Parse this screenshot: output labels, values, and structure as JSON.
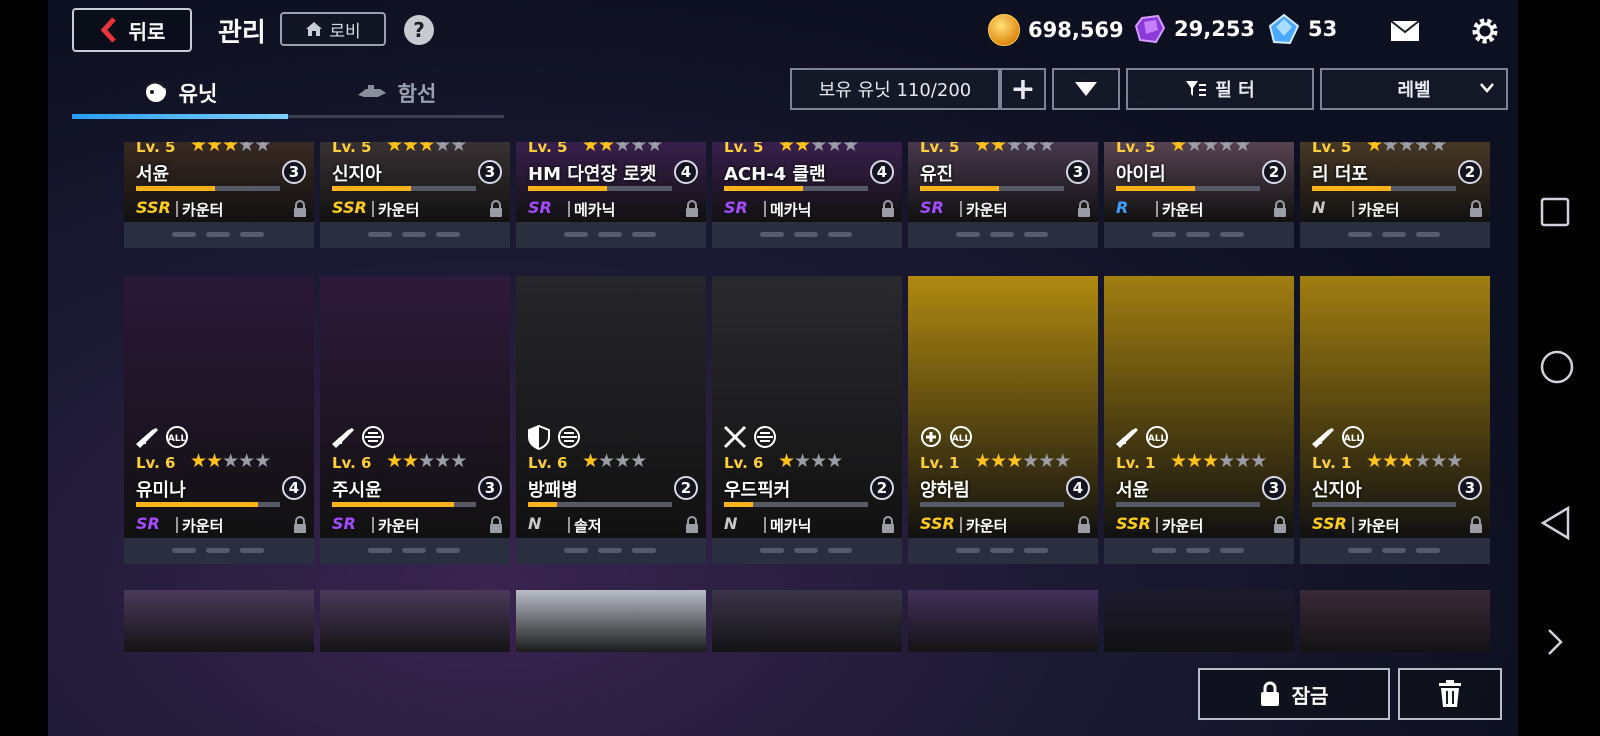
{
  "header": {
    "back_label": "뒤로",
    "title": "관리",
    "lobby_label": "로비",
    "help_label": "?",
    "currencies": [
      {
        "icon": "gold-coin-icon",
        "value": "698,569"
      },
      {
        "icon": "purple-gem-icon",
        "value": "29,253"
      },
      {
        "icon": "blue-crystal-icon",
        "value": "53"
      }
    ]
  },
  "tabs": [
    {
      "label": "유닛",
      "icon": "unit-head-icon",
      "active": true
    },
    {
      "label": "함선",
      "icon": "ship-icon",
      "active": false
    }
  ],
  "controls": {
    "owned_units": "보유 유닛 110/200",
    "add_label": "+",
    "filter_label": "필 터",
    "sort_label": "레벨"
  },
  "rows": [
    [
      {
        "level": "Lv. 5",
        "stars": 3,
        "max_stars": 5,
        "name": "서윤",
        "exp": 0.55,
        "badge": "3",
        "rarity": "SSR",
        "class": "카운터",
        "bg": "#3a2a24"
      },
      {
        "level": "Lv. 5",
        "stars": 3,
        "max_stars": 5,
        "name": "신지아",
        "exp": 0.55,
        "badge": "3",
        "rarity": "SSR",
        "class": "카운터",
        "bg": "#3a3336"
      },
      {
        "level": "Lv. 5",
        "stars": 2,
        "max_stars": 5,
        "name": "HM 다연장 로켓",
        "exp": 0.55,
        "badge": "4",
        "rarity": "SR",
        "class": "메카닉",
        "bg": "#3a2050"
      },
      {
        "level": "Lv. 5",
        "stars": 2,
        "max_stars": 5,
        "name": "ACH-4 클랜",
        "exp": 0.55,
        "badge": "4",
        "rarity": "SR",
        "class": "메카닉",
        "bg": "#3a2050"
      },
      {
        "level": "Lv. 5",
        "stars": 2,
        "max_stars": 5,
        "name": "유진",
        "exp": 0.55,
        "badge": "3",
        "rarity": "SR",
        "class": "카운터",
        "bg": "#4a3a50"
      },
      {
        "level": "Lv. 5",
        "stars": 1,
        "max_stars": 5,
        "name": "아이리",
        "exp": 0.55,
        "badge": "2",
        "rarity": "R",
        "class": "카운터",
        "bg": "#5a4654"
      },
      {
        "level": "Lv. 5",
        "stars": 1,
        "max_stars": 5,
        "name": "리 더포",
        "exp": 0.55,
        "badge": "2",
        "rarity": "N",
        "class": "카운터",
        "bg": "#4a3a26"
      }
    ],
    [
      {
        "level": "Lv. 6",
        "stars": 2,
        "max_stars": 5,
        "name": "유미나",
        "exp": 0.85,
        "badge": "4",
        "rarity": "SR",
        "class": "카운터",
        "bg": "#2a1838",
        "icons": [
          "rifle-icon",
          "all-target-icon"
        ]
      },
      {
        "level": "Lv. 6",
        "stars": 2,
        "max_stars": 5,
        "name": "주시윤",
        "exp": 0.85,
        "badge": "3",
        "rarity": "SR",
        "class": "카운터",
        "bg": "#2e1a3a",
        "icons": [
          "rifle-icon",
          "ground-target-icon"
        ]
      },
      {
        "level": "Lv. 6",
        "stars": 1,
        "max_stars": 4,
        "name": "방패병",
        "exp": 0.2,
        "badge": "2",
        "rarity": "N",
        "class": "솔저",
        "bg": "#26262a",
        "icons": [
          "shield-icon",
          "ground-target-icon"
        ]
      },
      {
        "level": "Lv. 6",
        "stars": 1,
        "max_stars": 4,
        "name": "우드픽커",
        "exp": 0.2,
        "badge": "2",
        "rarity": "N",
        "class": "메카닉",
        "bg": "#2a2a2e",
        "icons": [
          "crossed-swords-icon",
          "ground-target-icon"
        ]
      },
      {
        "level": "Lv. 1",
        "stars": 3,
        "max_stars": 6,
        "name": "양하림",
        "exp": 0.0,
        "badge": "4",
        "rarity": "SSR",
        "class": "카운터",
        "bg": "#b08a10",
        "icons": [
          "support-icon",
          "all-target-icon"
        ]
      },
      {
        "level": "Lv. 1",
        "stars": 3,
        "max_stars": 6,
        "name": "서윤",
        "exp": 0.0,
        "badge": "3",
        "rarity": "SSR",
        "class": "카운터",
        "bg": "#a07e10",
        "icons": [
          "rifle-icon",
          "all-target-icon"
        ]
      },
      {
        "level": "Lv. 1",
        "stars": 3,
        "max_stars": 6,
        "name": "신지아",
        "exp": 0.0,
        "badge": "3",
        "rarity": "SSR",
        "class": "카운터",
        "bg": "#a07e10",
        "icons": [
          "rifle-icon",
          "all-target-icon"
        ]
      }
    ],
    [
      {
        "bg": "#4a3a5a"
      },
      {
        "bg": "#4a3a5a"
      },
      {
        "bg": "#b8bcc6"
      },
      {
        "bg": "#3a3448"
      },
      {
        "bg": "#42305a"
      },
      {
        "bg": "#1e1a2e"
      },
      {
        "bg": "#3a2a36"
      }
    ]
  ],
  "bottom": {
    "lock_label": "잠금"
  }
}
